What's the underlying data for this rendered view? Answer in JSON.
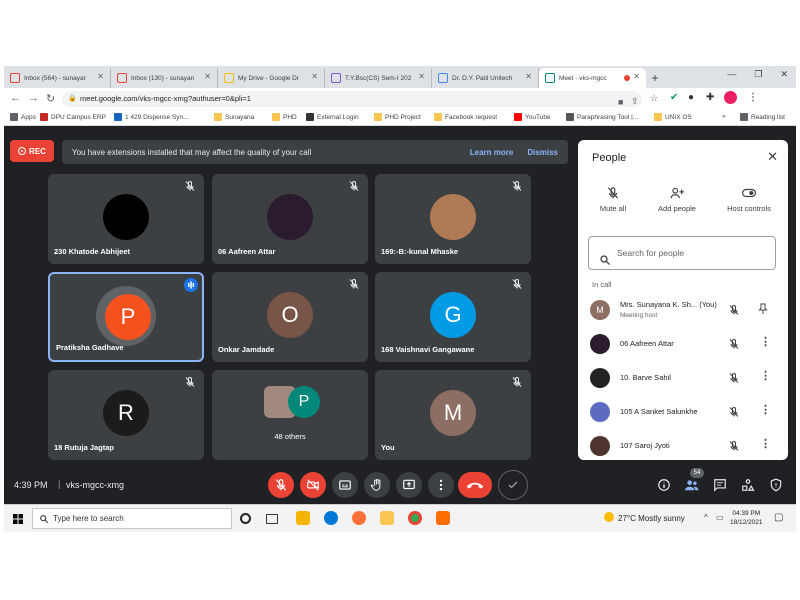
{
  "browser": {
    "tabs": [
      {
        "label": "Inbox (564) - sunayar",
        "icon": "gmail-icon",
        "color": "#ea4335",
        "active": false
      },
      {
        "label": "Inbox (130) - sunayan",
        "icon": "gmail-icon",
        "color": "#ea4335",
        "active": false
      },
      {
        "label": "My Drive - Google Dr",
        "icon": "drive-icon",
        "color": "#fbbc04",
        "active": false
      },
      {
        "label": "T.Y.Bsc(CS) Sem-I 202",
        "icon": "forms-icon",
        "color": "#7e57c2",
        "active": false
      },
      {
        "label": "Dr. D.Y. Patil Unitech",
        "icon": "sites-icon",
        "color": "#4285f4",
        "active": false
      },
      {
        "label": "Meet - vks-mgcc",
        "icon": "meet-icon",
        "color": "#00897b",
        "active": true
      }
    ],
    "new_tab": "+",
    "url": "meet.google.com/vks-mgcc-xmg?authuser=0&pli=1",
    "bookmarks": [
      {
        "label": "Apps",
        "icon": "apps-icon",
        "color": "#5f6368"
      },
      {
        "label": "DPU Campus ERP",
        "icon": "erp-icon",
        "color": "#c62828"
      },
      {
        "label": "1 429 Dispense Syn...",
        "icon": "dispense-icon",
        "color": "#1565c0"
      },
      {
        "label": "Sunayana",
        "icon": "folder-icon",
        "color": "#f9c74f"
      },
      {
        "label": "PHD",
        "icon": "folder-icon",
        "color": "#f9c74f"
      },
      {
        "label": "External Login",
        "icon": "globe-icon",
        "color": "#333333"
      },
      {
        "label": "PHD Project",
        "icon": "folder-icon",
        "color": "#f9c74f"
      },
      {
        "label": "Facebook request",
        "icon": "folder-icon",
        "color": "#f9c74f"
      },
      {
        "label": "YouTube",
        "icon": "youtube-icon",
        "color": "#ff0000"
      },
      {
        "label": "Paraphrasing Tool |...",
        "icon": "pen-icon",
        "color": "#555555"
      },
      {
        "label": "UNIX OS",
        "icon": "folder-icon",
        "color": "#f9c74f"
      }
    ],
    "bookmarks_more": "»",
    "reading_list": "Reading list"
  },
  "meet": {
    "rec_label": "REC",
    "banner": {
      "text": "You have extensions installed that may affect the quality of your call",
      "learn_more": "Learn more",
      "dismiss": "Dismiss"
    },
    "tiles": [
      {
        "name": "230 Khatode Abhijeet",
        "avatar_text": "",
        "avatar_color": "#000000",
        "muted": true
      },
      {
        "name": "06 Aafreen Attar",
        "avatar_text": "",
        "avatar_color": "#2b1b2e",
        "muted": true
      },
      {
        "name": "169:-B:-kunal Mhaske",
        "avatar_text": "",
        "avatar_color": "#b07a55",
        "muted": true
      },
      {
        "name": "Pratiksha Gadhave",
        "avatar_text": "P",
        "avatar_color": "#f4511e",
        "muted": false,
        "speaking": true
      },
      {
        "name": "Onkar Jamdade",
        "avatar_text": "O",
        "avatar_color": "#795548",
        "muted": true
      },
      {
        "name": "168 Vaishnavi Gangawane",
        "avatar_text": "G",
        "avatar_color": "#039be5",
        "muted": true
      },
      {
        "name": "18 Rutuja Jagtap",
        "avatar_text": "R",
        "avatar_color": "#1b1b1b",
        "muted": true
      },
      {
        "name": "48 others",
        "avatar_text": "P",
        "avatar_color": "#00897b",
        "muted": false
      },
      {
        "name": "You",
        "avatar_text": "M",
        "avatar_color": "#8d6e63",
        "muted": true
      }
    ],
    "time": "4:39 PM",
    "separator": "|",
    "meeting_code": "vks-mgcc-xmg",
    "people_count": "54"
  },
  "panel": {
    "title": "People",
    "controls": [
      {
        "label": "Mute all",
        "icon": "mic-off-icon"
      },
      {
        "label": "Add people",
        "icon": "add-person-icon"
      },
      {
        "label": "Host controls",
        "icon": "toggle-icon"
      }
    ],
    "search_placeholder": "Search for people",
    "section_label": "In call",
    "participants": [
      {
        "name": "Mrs. Sunayana K. Sh... (You)",
        "sub": "Meeting host",
        "avatar_text": "M",
        "avatar_color": "#8d6e63"
      },
      {
        "name": "06 Aafreen Attar",
        "sub": "",
        "avatar_text": "",
        "avatar_color": "#2b1b2e"
      },
      {
        "name": "10. Barve Sahil",
        "sub": "",
        "avatar_text": "",
        "avatar_color": "#222222"
      },
      {
        "name": "105 A Sanket Salunkhe",
        "sub": "",
        "avatar_text": "",
        "avatar_color": "#5c6bc0"
      },
      {
        "name": "107 Saroj Jyoti",
        "sub": "",
        "avatar_text": "",
        "avatar_color": "#4e342e"
      }
    ]
  },
  "taskbar": {
    "search_placeholder": "Type here to search",
    "weather": "27°C  Mostly sunny",
    "clock_time": "04:39 PM",
    "clock_date": "18/12/2021"
  }
}
